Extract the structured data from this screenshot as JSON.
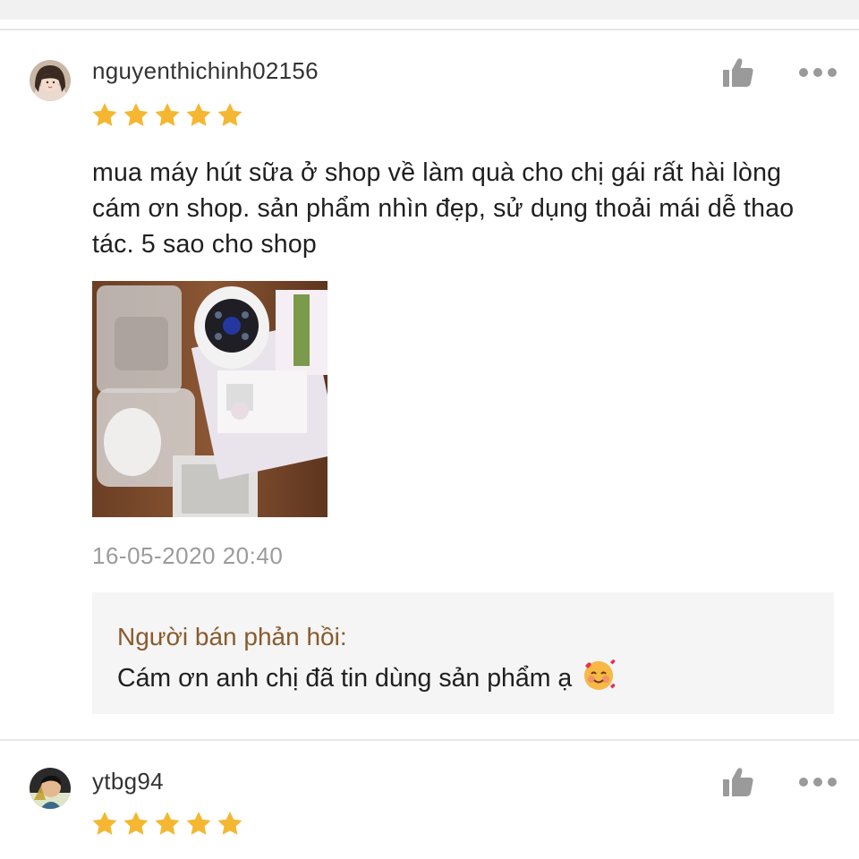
{
  "reviews": [
    {
      "username": "nguyenthichinh02156",
      "rating": 5,
      "comment": "mua máy hút sữa ở shop về làm quà cho chị gái rất hài lòng cám ơn shop. sản phẩm nhìn đẹp, sử dụng thoải mái dễ thao tác. 5 sao cho shop",
      "timestamp": "16-05-2020 20:40",
      "seller_reply": {
        "label": "Người bán phản hồi:",
        "text": "Cám ơn anh chị đã tin dùng sản phẩm ạ",
        "emoji": "smiling-face-with-hearts-icon"
      }
    },
    {
      "username": "ytbg94",
      "rating": 5
    }
  ],
  "colors": {
    "star": "#F5B731",
    "reply_label": "#8A5A2B",
    "timestamp": "#9B9B9B",
    "icon_gray": "#9A9A9A",
    "reply_bg": "#F5F5F5"
  },
  "icons": {
    "like": "thumbs-up-icon",
    "more": "more-options-icon"
  }
}
